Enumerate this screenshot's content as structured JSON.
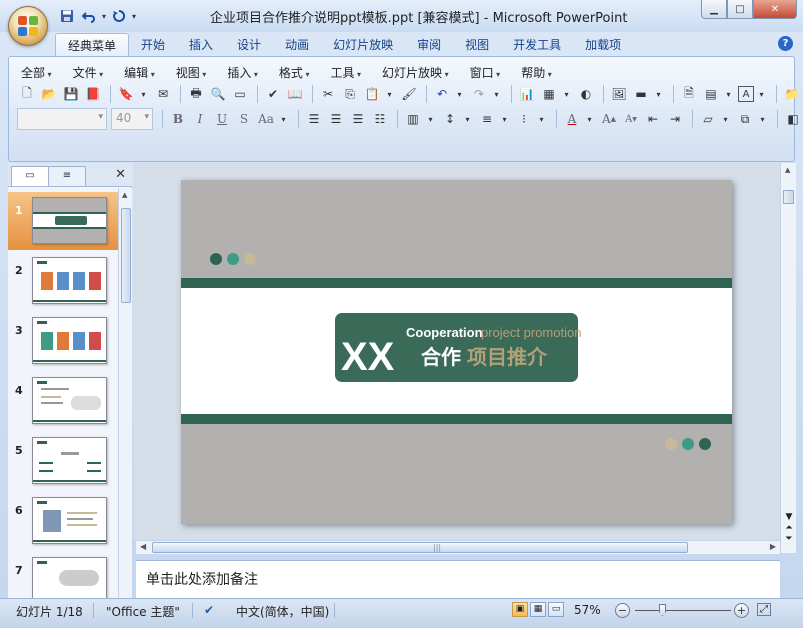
{
  "window": {
    "title": "企业项目合作推介说明ppt模板.ppt [兼容模式] - Microsoft PowerPoint"
  },
  "quick_access": [
    "save-icon",
    "undo-icon",
    "redo-icon"
  ],
  "tabs": [
    {
      "label": "经典菜单",
      "active": true
    },
    {
      "label": "开始"
    },
    {
      "label": "插入"
    },
    {
      "label": "设计"
    },
    {
      "label": "动画"
    },
    {
      "label": "幻灯片放映"
    },
    {
      "label": "审阅"
    },
    {
      "label": "视图"
    },
    {
      "label": "开发工具"
    },
    {
      "label": "加载项"
    }
  ],
  "menus": [
    "全部",
    "文件",
    "编辑",
    "视图",
    "插入",
    "格式",
    "工具",
    "幻灯片放映",
    "窗口",
    "帮助"
  ],
  "toolbar": {
    "font_name": "",
    "font_size": "40"
  },
  "left_pane": {
    "slide_numbers": [
      "1",
      "2",
      "3",
      "4",
      "5",
      "6",
      "7"
    ]
  },
  "slide": {
    "badge_big": "XX",
    "badge_en_1": "Cooperation",
    "badge_en_2": "project promotion",
    "badge_cn_1": "合作",
    "badge_cn_2": "项目推介",
    "colors": {
      "background": "#b2b1af",
      "green": "#2f6452",
      "teal": "#3d9c85",
      "beige": "#c7b997",
      "badge": "#3a6a58",
      "tan": "#b3a079"
    }
  },
  "notes": {
    "placeholder": "单击此处添加备注"
  },
  "status": {
    "slide_counter": "幻灯片 1/18",
    "theme": "\"Office 主题\"",
    "language": "中文(简体，中国)",
    "zoom": "57%"
  }
}
